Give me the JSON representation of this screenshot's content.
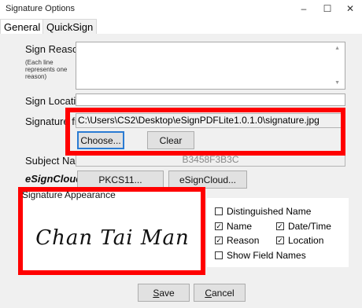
{
  "window": {
    "title": "Signature Options",
    "minimize": "–",
    "maximize": "☐",
    "close": "✕"
  },
  "tabs": [
    {
      "label": "General",
      "active": true
    },
    {
      "label": "QuickSign",
      "active": false
    }
  ],
  "form": {
    "sign_reason_label": "Sign Reason",
    "sign_reason_hint": "(Each line represents one reason)",
    "sign_reason_value": "",
    "sign_location_label": "Sign Location",
    "sign_location_value": "",
    "signature_file_label": "Signature file",
    "signature_file_value": "C:\\Users\\CS2\\Desktop\\eSignPDFLite1.0.1.0\\signature.jpg",
    "choose_button": "Choose...",
    "clear_button": "Clear",
    "subject_name_label": "Subject Name",
    "subject_name_value": "B3458F3B3C",
    "esigncloud_label": "eSignCloud",
    "pkcs11_button": "PKCS11...",
    "esigncloud_button": "eSignCloud..."
  },
  "appearance": {
    "group_label": "Signature Appearance",
    "signature_preview_text": "Chan Tai Man",
    "options": {
      "distinguished_name": {
        "label": "Distinguished Name",
        "checked": false
      },
      "name": {
        "label": "Name",
        "checked": true
      },
      "date_time": {
        "label": "Date/Time",
        "checked": true
      },
      "reason": {
        "label": "Reason",
        "checked": true
      },
      "location": {
        "label": "Location",
        "checked": true
      },
      "show_field_names": {
        "label": "Show Field Names",
        "checked": false
      }
    }
  },
  "footer": {
    "save_button": "Save",
    "save_accel": "S",
    "save_rest": "ave",
    "cancel_button": "Cancel",
    "cancel_accel": "C",
    "cancel_rest": "ancel"
  },
  "colors": {
    "highlight": "#ff0000",
    "panel_bg": "#f0f0f0",
    "focus_border": "#2a7bd3"
  }
}
